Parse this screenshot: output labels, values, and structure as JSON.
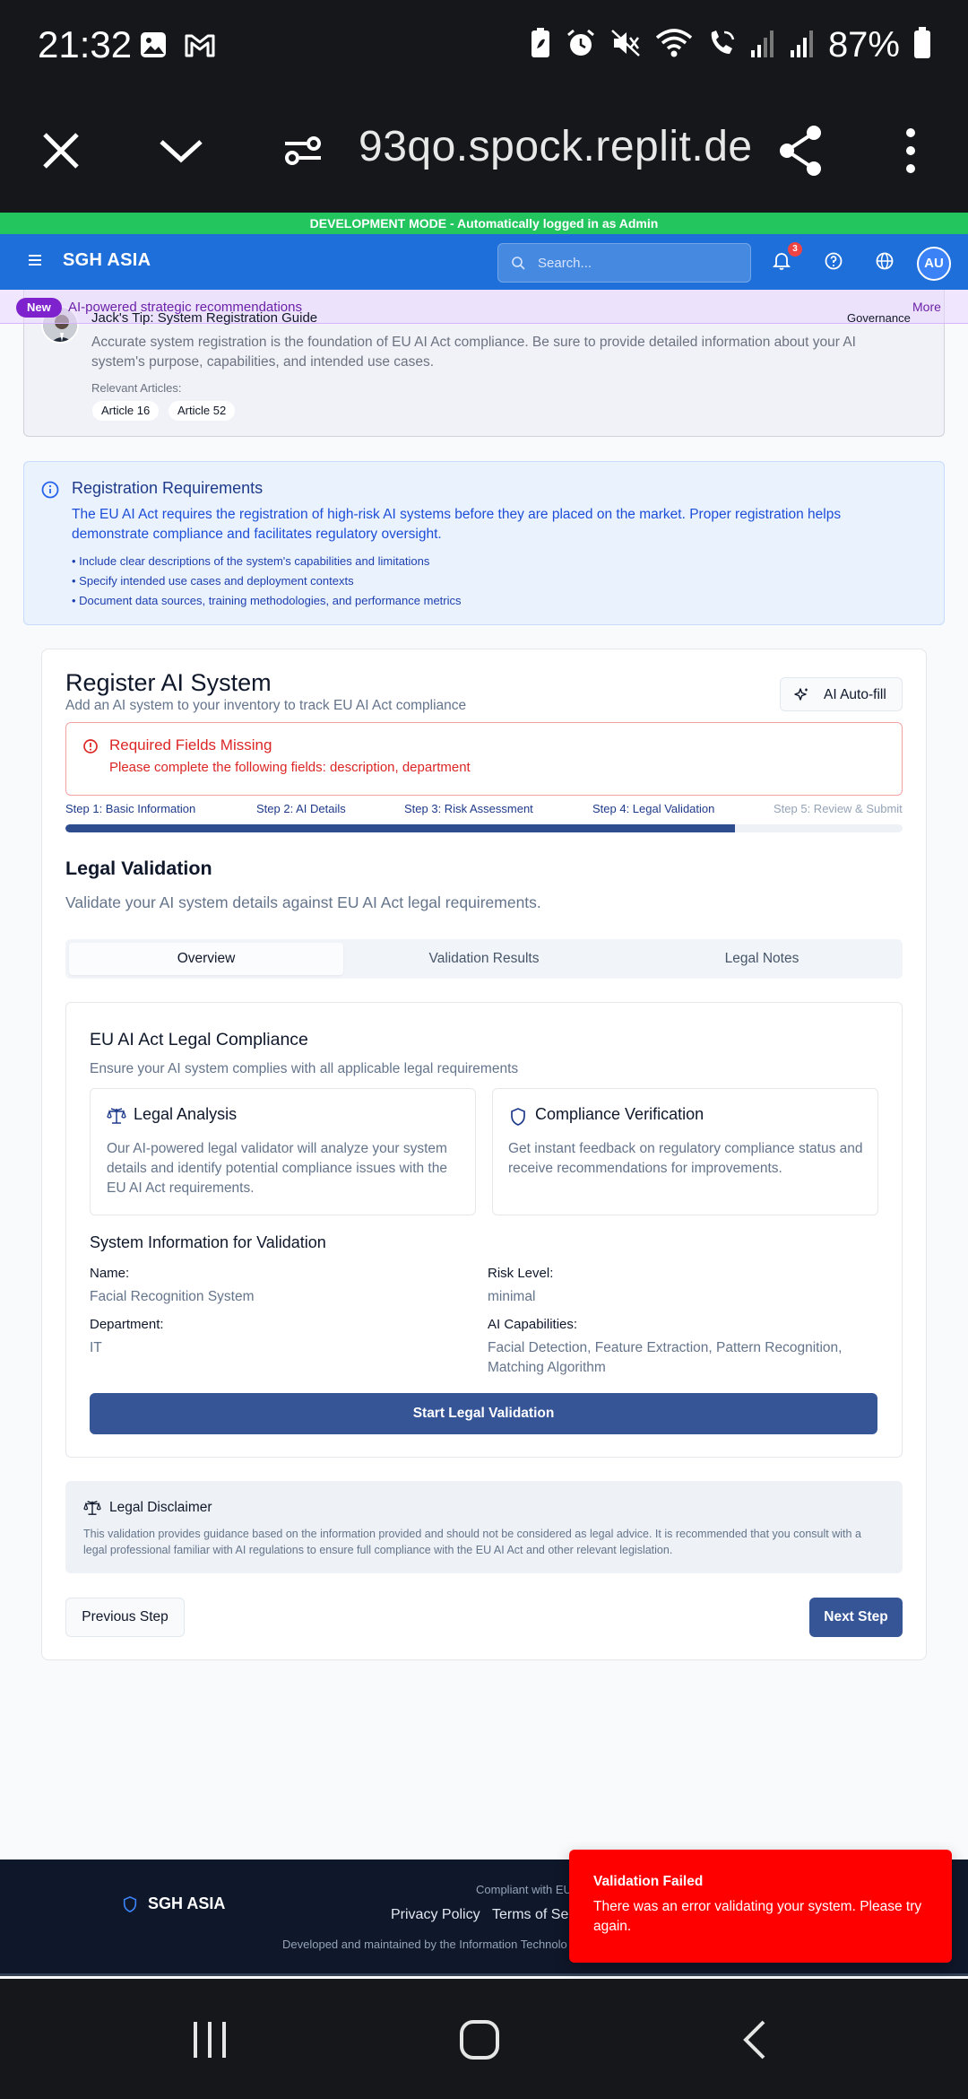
{
  "status_bar": {
    "time": "21:32",
    "battery": "87%",
    "left_icons": [
      "image-icon",
      "gmail-icon"
    ],
    "right_icons": [
      "battery-saver-icon",
      "alarm-icon",
      "mute-icon",
      "wifi-icon",
      "wifi-calling-icon",
      "signal-icon",
      "signal-icon",
      "battery-icon"
    ]
  },
  "browser": {
    "url": "93qo.spock.replit.dev"
  },
  "dev_banner": "DEVELOPMENT MODE - Automatically logged in as Admin",
  "header": {
    "brand": "SGH ASIA",
    "search_placeholder": "Search...",
    "notification_count": "3",
    "avatar_initials": "AU"
  },
  "recommendations": {
    "badge": "New",
    "text": "AI-powered strategic recommendations",
    "more": "More"
  },
  "tip": {
    "title": "Jack's Tip: System Registration Guide",
    "category": "Governance",
    "body": "Accurate system registration is the foundation of EU AI Act compliance. Be sure to provide detailed information about your AI system's purpose, capabilities, and intended use cases.",
    "relevant_label": "Relevant Articles:",
    "articles": [
      "Article 16",
      "Article 52"
    ]
  },
  "requirements": {
    "title": "Registration Requirements",
    "body": "The EU AI Act requires the registration of high-risk AI systems before they are placed on the market. Proper registration helps demonstrate compliance and facilitates regulatory oversight.",
    "items": [
      "Include clear descriptions of the system's capabilities and limitations",
      "Specify intended use cases and deployment contexts",
      "Document data sources, training methodologies, and performance metrics"
    ]
  },
  "register": {
    "title": "Register AI System",
    "subtitle": "Add an AI system to your inventory to track EU AI Act compliance",
    "autofill_label": "AI Auto-fill",
    "error_title": "Required Fields Missing",
    "error_body": "Please complete the following fields: description, department",
    "steps": [
      "Step 1: Basic Information",
      "Step 2: AI Details",
      "Step 3: Risk Assessment",
      "Step 4: Legal Validation",
      "Step 5: Review & Submit"
    ],
    "current_step": 4,
    "progress_percent": 80
  },
  "legal": {
    "title": "Legal Validation",
    "subtitle": "Validate your AI system details against EU AI Act legal requirements.",
    "tabs": [
      "Overview",
      "Validation Results",
      "Legal Notes"
    ],
    "active_tab": "Overview",
    "card_title": "EU AI Act Legal Compliance",
    "card_subtitle": "Ensure your AI system complies with all applicable legal requirements",
    "analysis_title": "Legal Analysis",
    "analysis_body": "Our AI-powered legal validator will analyze your system details and identify potential compliance issues with the EU AI Act requirements.",
    "verification_title": "Compliance Verification",
    "verification_body": "Get instant feedback on regulatory compliance status and receive recommendations for improvements.",
    "sysinfo_title": "System Information for Validation",
    "name_label": "Name:",
    "name_value": "Facial Recognition System",
    "risk_label": "Risk Level:",
    "risk_value": "minimal",
    "dept_label": "Department:",
    "dept_value": "IT",
    "cap_label": "AI Capabilities:",
    "cap_value": "Facial Detection, Feature Extraction, Pattern Recognition, Matching Algorithm",
    "start_button": "Start Legal Validation",
    "disclaimer_title": "Legal Disclaimer",
    "disclaimer_body": "This validation provides guidance based on the information provided and should not be considered as legal advice. It is recommended that you consult with a legal professional familiar with AI regulations to ensure full compliance with the EU AI Act and other relevant legislation.",
    "prev_button": "Previous Step",
    "next_button": "Next Step"
  },
  "footer": {
    "brand": "SGH ASIA",
    "compliant": "Compliant with EU",
    "privacy": "Privacy Policy",
    "terms": "Terms of Se",
    "developed": "Developed and maintained by the Information Technolo"
  },
  "toast": {
    "title": "Validation Failed",
    "body": "There was an error validating your system. Please try again.",
    "color": "#ff0000"
  },
  "colors": {
    "header_blue": "#1e6fd9",
    "primary_button": "#355597",
    "dev_green": "#22c55e",
    "error_red": "#dc2626"
  }
}
